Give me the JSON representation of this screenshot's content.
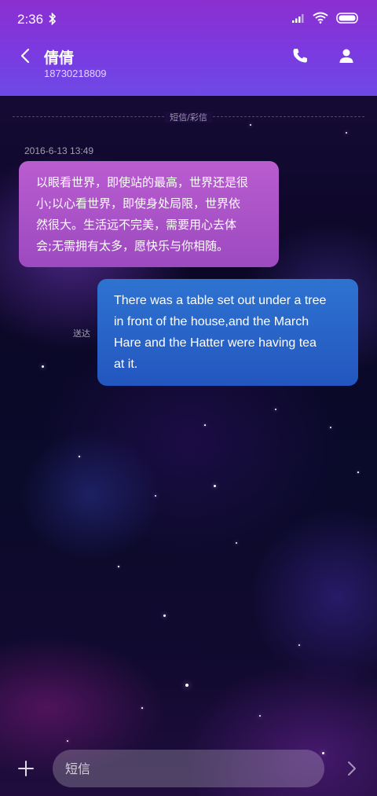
{
  "status_bar": {
    "time": "2:36"
  },
  "header": {
    "contact_name": "倩倩",
    "contact_number": "18730218809"
  },
  "conversation": {
    "channel_label": "短信/彩信",
    "timestamp": "2016-6-13 13:49",
    "messages": [
      {
        "direction": "incoming",
        "lines": [
          "以眼看世界，即使站的最高，世界还是很",
          "小;以心看世界，即使身处局限，世界依",
          "然很大。生活远不完美，需要用心去体",
          "会;无需拥有太多，愿快乐与你相随。"
        ]
      },
      {
        "direction": "outgoing",
        "status": "送达",
        "lines": [
          "There was a table set out under a tree",
          "in front of the house,and the March",
          "Hare and the Hatter were having tea",
          "at it."
        ]
      }
    ]
  },
  "composer": {
    "placeholder": "短信"
  },
  "colors": {
    "header_top": "#8c2fd0",
    "header_bottom": "#6e49e6",
    "incoming_bubble": "#b95dd0",
    "outgoing_bubble": "#2e73d0"
  },
  "icons": {
    "bluetooth": "bluetooth-icon",
    "signal": "signal-icon",
    "wifi": "wifi-icon",
    "battery": "battery-icon",
    "back": "back-arrow-icon",
    "call": "phone-icon",
    "contact": "person-icon",
    "add": "plus-icon",
    "send": "chevron-right-icon"
  }
}
